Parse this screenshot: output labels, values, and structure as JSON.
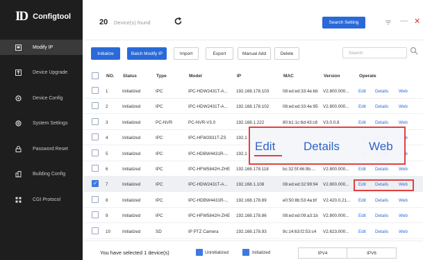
{
  "app": {
    "logo": "ID",
    "title": "Configtool"
  },
  "sidebar": {
    "items": [
      {
        "label": "Modify IP",
        "icon": "modify-ip-icon",
        "active": true
      },
      {
        "label": "Device Upgrade",
        "icon": "upgrade-icon"
      },
      {
        "label": "Device Config",
        "icon": "config-icon"
      },
      {
        "label": "System Settings",
        "icon": "settings-icon"
      },
      {
        "label": "Password Reset",
        "icon": "lock-icon"
      },
      {
        "label": "Building Config",
        "icon": "building-icon"
      },
      {
        "label": "CGI Protocol",
        "icon": "grid-icon"
      }
    ]
  },
  "topbar": {
    "device_count": "20",
    "device_count_label": "Device(s) found",
    "search_setting": "Search Setting"
  },
  "toolbar": {
    "initialize": "Initialize",
    "batch_modify": "Batch Modify IP",
    "import": "Import",
    "export": "Export",
    "manual_add": "Manual Add",
    "delete": "Delete",
    "search_placeholder": "Search"
  },
  "table": {
    "headers": {
      "no": "NO.",
      "status": "Status",
      "type": "Type",
      "model": "Model",
      "ip": "IP",
      "mac": "MAC",
      "version": "Version",
      "operate": "Operate"
    },
    "rows": [
      {
        "no": "1",
        "status": "Initialized",
        "type": "IPC",
        "model": "IPC-HDW2431T-A...",
        "ip": "192.168.178.103",
        "mac": "08:ed:ed:33:4e:bb",
        "version": "V2.800.000..."
      },
      {
        "no": "2",
        "status": "Initialized",
        "type": "IPC",
        "model": "IPC-HDW2431T-A...",
        "ip": "192.168.178.102",
        "mac": "08:ed:ed:33:4e:95",
        "version": "V2.800.000..."
      },
      {
        "no": "3",
        "status": "Initialized",
        "type": "PC-NVR",
        "model": "PC-NVR-V3.0",
        "ip": "192.168.1.222",
        "mac": "80:b1:1c:6d:43:c8",
        "version": "V3.0.0.8"
      },
      {
        "no": "4",
        "status": "Initialized",
        "type": "IPC",
        "model": "IPC-HFW2831T-ZS",
        "ip": "192.1",
        "mac": "",
        "version": ""
      },
      {
        "no": "5",
        "status": "Initialized",
        "type": "IPC",
        "model": "IPC-HDBW4431R-...",
        "ip": "192.1",
        "mac": "",
        "version": ""
      },
      {
        "no": "6",
        "status": "Initialized",
        "type": "IPC",
        "model": "IPC-HFW5842H-ZHE",
        "ip": "192.168.178.118",
        "mac": "bc:32:5f:46:9b:...",
        "version": "V2.800.000..."
      },
      {
        "no": "7",
        "status": "Initialized",
        "type": "IPC",
        "model": "IPC-HDW2431T-A...",
        "ip": "192.168.1.108",
        "mac": "08:ed:ed:32:99:94",
        "version": "V2.800.000..."
      },
      {
        "no": "8",
        "status": "Initialized",
        "type": "IPC",
        "model": "IPC-HDBW4431R-...",
        "ip": "192.168.178.89",
        "mac": "e0:50:8b:53:4a:bf",
        "version": "V2.420.0.21..."
      },
      {
        "no": "9",
        "status": "Initialized",
        "type": "IPC",
        "model": "IPC-HFW5842H-ZHE",
        "ip": "192.168.178.86",
        "mac": "08:ed:ed:09:a3:1b",
        "version": "V2.800.000..."
      },
      {
        "no": "10",
        "status": "Initialized",
        "type": "SD",
        "model": "IP PTZ Camera",
        "ip": "192.168.178.93",
        "mac": "9c:14:63:f2:53:c4",
        "version": "V2.623.000..."
      }
    ],
    "ops": {
      "edit": "Edit",
      "details": "Details",
      "web": "Web"
    },
    "selected_row": 7
  },
  "zoom_callout": {
    "edit": "Edit",
    "details": "Details",
    "web": "Web"
  },
  "footer": {
    "selected_text": "You have selected 1 device(s)",
    "legend_uninitialized": "Uninitialized",
    "legend_initialized": "Initialized",
    "tab_ipv4": "IPV4",
    "tab_ipv6": "IPV6"
  },
  "colors": {
    "accent": "#2a6ad8",
    "sidebar": "#1e1e1e",
    "highlight": "#e04040"
  }
}
